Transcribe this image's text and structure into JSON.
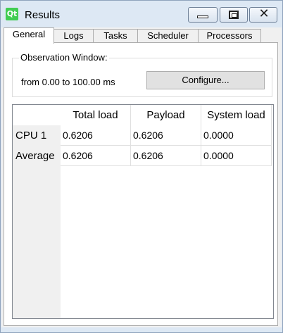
{
  "window": {
    "app_icon_text": "Qt",
    "title": "Results",
    "controls": [
      "minimize-icon",
      "maximize-icon",
      "close-icon"
    ],
    "close_glyph": "✕"
  },
  "tabs": [
    {
      "label": "General",
      "active": true
    },
    {
      "label": "Logs",
      "active": false
    },
    {
      "label": "Tasks",
      "active": false
    },
    {
      "label": "Scheduler",
      "active": false
    },
    {
      "label": "Processors",
      "active": false
    }
  ],
  "observation": {
    "group_title": "Observation Window:",
    "range_text": "from 0.00 to 100.00 ms",
    "configure_label": "Configure..."
  },
  "table": {
    "columns": [
      "Total load",
      "Payload",
      "System load"
    ],
    "rows": [
      {
        "label": "CPU 1",
        "values": [
          "0.6206",
          "0.6206",
          "0.0000"
        ]
      },
      {
        "label": "Average",
        "values": [
          "0.6206",
          "0.6206",
          "0.0000"
        ]
      }
    ]
  },
  "colors": {
    "qt_green": "#41cd52",
    "window_frame": "#dde8f4",
    "header_gray": "#f0f0f0"
  }
}
